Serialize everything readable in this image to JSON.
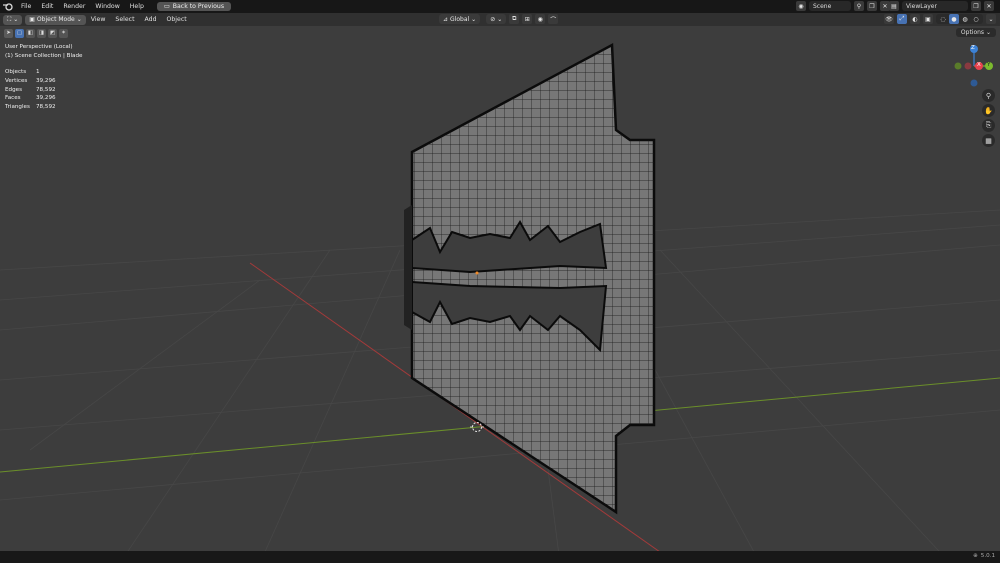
{
  "menubar": {
    "items": [
      "File",
      "Edit",
      "Render",
      "Window",
      "Help"
    ],
    "back_button": "Back to Previous",
    "scene": "Scene",
    "view_layer": "ViewLayer"
  },
  "header": {
    "mode": "Object Mode",
    "menus": [
      "View",
      "Select",
      "Add",
      "Object"
    ],
    "orientation": "Global"
  },
  "viewport": {
    "options_label": "Options",
    "perspective": "User Perspective (Local)",
    "collection": "(1) Scene Collection | Blade",
    "stats": [
      {
        "label": "Objects",
        "value": "1"
      },
      {
        "label": "Vertices",
        "value": "39,296"
      },
      {
        "label": "Edges",
        "value": "78,592"
      },
      {
        "label": "Faces",
        "value": "39,296"
      },
      {
        "label": "Triangles",
        "value": "78,592"
      }
    ],
    "gizmo": {
      "z": "Z",
      "x": "X",
      "y": "Y"
    }
  },
  "statusbar": {
    "version": "5.0.1"
  },
  "colors": {
    "background": "#3d3d3d",
    "x_axis": "#a33a3a",
    "y_axis": "#6b8f2a",
    "x_gizmo": "#e8424f",
    "y_gizmo": "#7cba2e",
    "z_gizmo": "#3c82d6",
    "accent": "#4772b3"
  }
}
